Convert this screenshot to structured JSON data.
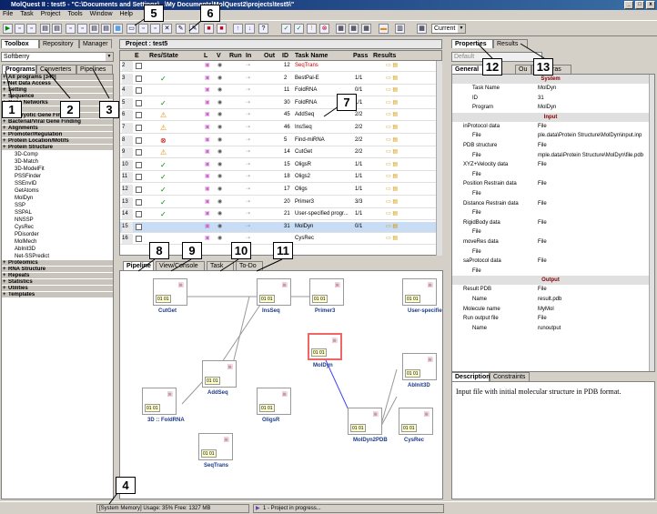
{
  "app": {
    "title": "MolQuest II : test5 - \"C:\\Documents and Settings\\...\\My Documents\\MolQuest2\\projects\\test5\\\""
  },
  "menu": [
    "File",
    "Task",
    "Project",
    "Tools",
    "Window",
    "Help"
  ],
  "toolbar": {
    "view_select": "Current"
  },
  "left": {
    "tabs": [
      "Toolbox",
      "Repository",
      "Manager"
    ],
    "combo": "Softberry",
    "subtabs": [
      "Programs",
      "Converters",
      "Pipelines"
    ],
    "categories_top": [
      "All programs [340]",
      "Net Data Access",
      "Setting",
      "Sequence",
      "Gene Networks",
      "Blast",
      "Eukaryotic Gene Finding",
      "Bacterial/Viral Gene Finding",
      "Alignments",
      "Promoter/Regulation",
      "Protein Location/Motifs",
      "Protein Structure"
    ],
    "programs": [
      "3D-Comp",
      "3D-Match",
      "3D-ModelFit",
      "PSSFinder",
      "SSEnvID",
      "GetAtoms",
      "MolDyn",
      "SSP",
      "SSPAL",
      "NNSSP",
      "CysRec",
      "PDisorder",
      "MolMech",
      "AbInit3D",
      "Net-SSPredict"
    ],
    "categories_bottom": [
      "Proteomics",
      "RNA Structure",
      "Repeats",
      "Statistics",
      "Utilities",
      "Templates"
    ]
  },
  "project": {
    "title": "Project : test5",
    "columns": [
      "",
      "E",
      "Res/State",
      "L",
      "V",
      "Run",
      "In",
      "Out",
      "ID",
      "Task Name",
      "Pass",
      "Results"
    ],
    "rows": [
      {
        "n": "2",
        "id": "12",
        "name": "SeqTrans",
        "pass": "",
        "red": true
      },
      {
        "n": "3",
        "id": "2",
        "name": "BestPal-E",
        "pass": "1/1"
      },
      {
        "n": "4",
        "id": "11",
        "name": "FoldRNA",
        "pass": "0/1"
      },
      {
        "n": "5",
        "id": "30",
        "name": "FoldRNA",
        "pass": "1/1"
      },
      {
        "n": "6",
        "id": "45",
        "name": "AddSeq",
        "pass": "2/2"
      },
      {
        "n": "7",
        "id": "46",
        "name": "InsSeq",
        "pass": "2/2"
      },
      {
        "n": "8",
        "id": "5",
        "name": "Find-miRNA",
        "pass": "2/2"
      },
      {
        "n": "9",
        "id": "14",
        "name": "CutGet",
        "pass": "2/2"
      },
      {
        "n": "10",
        "id": "15",
        "name": "OligsR",
        "pass": "1/1"
      },
      {
        "n": "11",
        "id": "18",
        "name": "Oligs2",
        "pass": "1/1"
      },
      {
        "n": "12",
        "id": "17",
        "name": "Oligs",
        "pass": "1/1"
      },
      {
        "n": "13",
        "id": "20",
        "name": "Primer3",
        "pass": "3/3"
      },
      {
        "n": "14",
        "id": "21",
        "name": "User-specified progr...",
        "pass": "1/1"
      },
      {
        "n": "15",
        "id": "31",
        "name": "MolDyn",
        "pass": "0/1",
        "sel": true
      },
      {
        "n": "16",
        "id": "",
        "name": "CysRec",
        "pass": ""
      }
    ],
    "bottom_tabs": [
      "Pipeline",
      "View/Console",
      "Task",
      "To-Do"
    ]
  },
  "pipeline_nodes": [
    {
      "label": "CutGet"
    },
    {
      "label": "InsSeq"
    },
    {
      "label": "Primer3"
    },
    {
      "label": "User-specified program run"
    },
    {
      "label": "MolDyn"
    },
    {
      "label": "AbInit3D"
    },
    {
      "label": "AddSeq"
    },
    {
      "label": "3D :: FoldRNA"
    },
    {
      "label": "OligsR"
    },
    {
      "label": "MolDyn2PDB"
    },
    {
      "label": "CysRec"
    },
    {
      "label": "SeqTrans"
    }
  ],
  "right": {
    "tabs": [
      "Properties",
      "Results"
    ],
    "combo": "Default",
    "subtabs": [
      "General",
      "Ou",
      "sk Extras"
    ],
    "sections": [
      "System",
      "Input",
      "Output"
    ],
    "system": [
      {
        "k": "Task Name",
        "v": "MolDyn"
      },
      {
        "k": "ID",
        "v": "31"
      },
      {
        "k": "Program",
        "v": "MolDyn"
      }
    ],
    "input": [
      {
        "k": "inProtocol data",
        "v": "File"
      },
      {
        "k": "File",
        "v": "ple.data\\Protein Structure\\MolDyn\\input.inp"
      },
      {
        "k": "PDB structure",
        "v": "File"
      },
      {
        "k": "File",
        "v": "mple.data\\Protein Structure\\MolDyn\\file.pdb"
      },
      {
        "k": "XYZ+Velocity data",
        "v": "File"
      },
      {
        "k": "File",
        "v": ""
      },
      {
        "k": "Position Restrain data",
        "v": "File"
      },
      {
        "k": "File",
        "v": ""
      },
      {
        "k": "Distance Restrain data",
        "v": "File"
      },
      {
        "k": "File",
        "v": ""
      },
      {
        "k": "RigidBody data",
        "v": "File"
      },
      {
        "k": "File",
        "v": ""
      },
      {
        "k": "moveRes data",
        "v": "File"
      },
      {
        "k": "File",
        "v": ""
      },
      {
        "k": "saProtocol data",
        "v": "File"
      },
      {
        "k": "File",
        "v": ""
      }
    ],
    "output": [
      {
        "k": "Result PDB",
        "v": "File"
      },
      {
        "k": "Name",
        "v": "result.pdb"
      },
      {
        "k": "Molecule name",
        "v": "MyMol"
      },
      {
        "k": "Run output file",
        "v": "File"
      },
      {
        "k": "Name",
        "v": "runoutput"
      }
    ],
    "desc_tabs": [
      "Description",
      "Constraints"
    ],
    "description": "Input file with initial molecular structure in PDB format."
  },
  "status": {
    "memory": "[System Memory] Usage: 35%  Free: 1327 MB",
    "progress": "1 - Project in progress..."
  },
  "callouts": [
    "1",
    "2",
    "3",
    "4",
    "5",
    "6",
    "7",
    "8",
    "9",
    "10",
    "11",
    "12",
    "13"
  ]
}
